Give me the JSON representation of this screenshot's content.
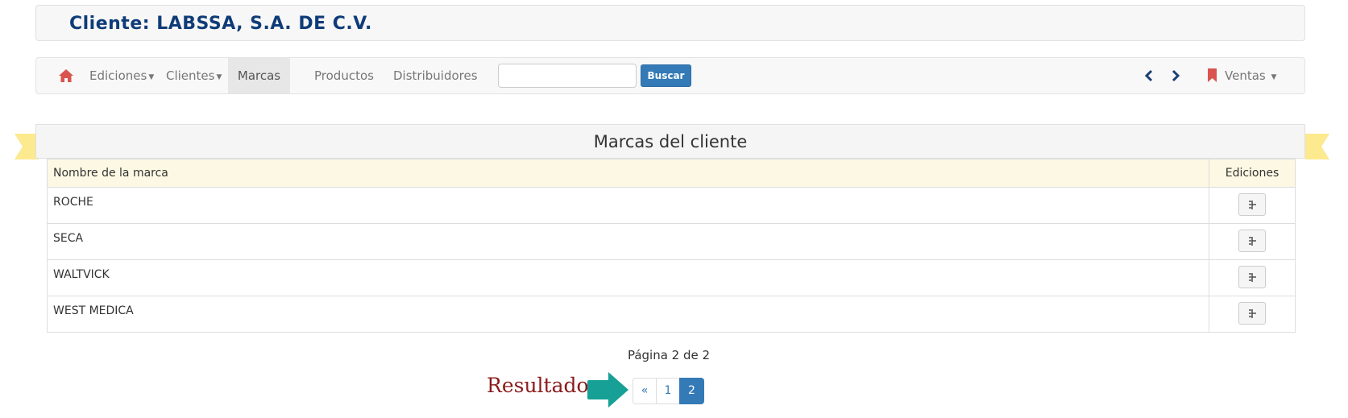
{
  "header": {
    "client_title": "Cliente: LABSSA, S.A. DE C.V."
  },
  "navbar": {
    "items": [
      {
        "label": "Ediciones",
        "dropdown": true
      },
      {
        "label": "Clientes",
        "dropdown": true
      },
      {
        "label": "Marcas",
        "active": true
      },
      {
        "label": "Productos"
      },
      {
        "label": "Distribuidores"
      }
    ],
    "search_placeholder": "",
    "search_button": "Buscar",
    "ventas_label": "Ventas",
    "accent_home": "#d9534f"
  },
  "panel": {
    "title": "Marcas del cliente"
  },
  "table": {
    "columns": [
      "Nombre de la marca",
      "Ediciones"
    ],
    "rows": [
      {
        "name": "ROCHE"
      },
      {
        "name": "SECA"
      },
      {
        "name": "WALTVICK"
      },
      {
        "name": "WEST MEDICA"
      }
    ]
  },
  "pagination": {
    "status": "Página 2 de 2",
    "prev": "«",
    "pages": [
      "1",
      "2"
    ],
    "active_page": "2"
  },
  "annotation": {
    "label": "Resultado",
    "arrow_color": "#17a095",
    "label_color": "#8b1a1a"
  }
}
